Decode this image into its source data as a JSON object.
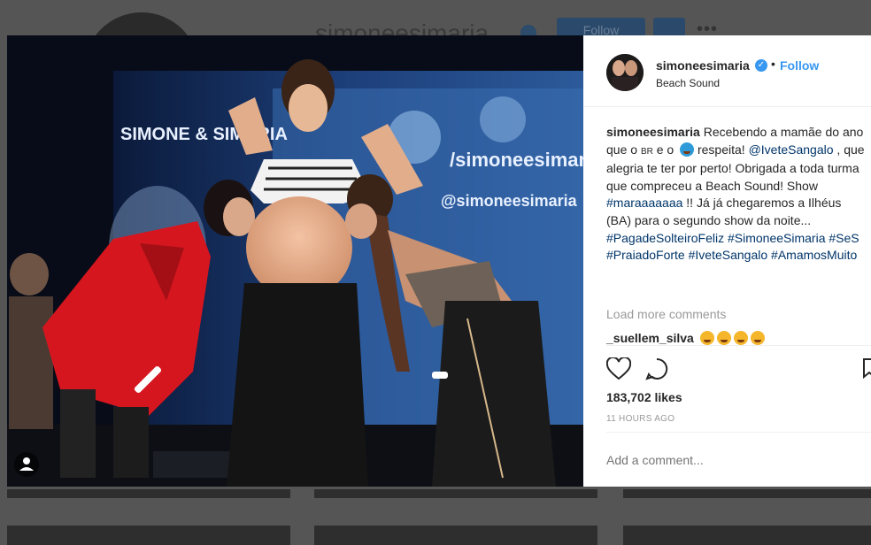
{
  "profile_bg": {
    "username": "simoneesimaria",
    "follow_label": "Follow",
    "more_label": "•••"
  },
  "post": {
    "author": "simoneesimaria",
    "verified": true,
    "separator": "•",
    "follow_label": "Follow",
    "location": "Beach Sound",
    "photo_banner_text": "SIMONE & SIMARIA",
    "photo_handle": "/simoneesimaria",
    "photo_handle2": "@simoneesimaria",
    "caption": {
      "author": "simoneesimaria",
      "text_1": "Recebendo a mamãe do ano que o ",
      "br": "BR",
      "text_2": " e o ",
      "text_3": " respeita! ",
      "mention": "@IveteSangalo",
      "text_4": " , que alegria te ter por perto! Obrigada a toda turma que compreceu a Beach Sound! Show ",
      "tag_1": "#maraaaaaaa",
      "text_5": " !! Já já chegaremos a Ilhéus (BA) para o segundo show da noite... ",
      "tag_2": "#PagadeSolteiroFeliz",
      "tag_3": "#SimoneeSimaria",
      "tag_4": "#SeS",
      "tag_5": "#PraiadoForte",
      "tag_6": "#IveteSangalo",
      "tag_7": "#AmamosMuito"
    },
    "load_more": "Load more comments",
    "comment": {
      "author": "_suellem_silva",
      "emoji_count": 4
    },
    "likes": "183,702 likes",
    "time": "11 HOURS AGO",
    "add_comment_placeholder": "Add a comment...",
    "options": "⋮"
  },
  "icons": [
    "heart-icon",
    "comment-icon",
    "bookmark-icon",
    "user-tag-icon",
    "verified-icon"
  ],
  "colors": {
    "accent": "#3897f0",
    "tag": "#003569",
    "text": "#262626",
    "muted": "#999999"
  }
}
